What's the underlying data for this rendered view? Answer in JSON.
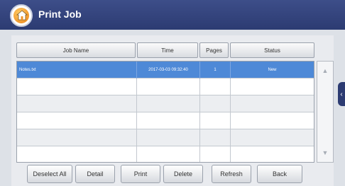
{
  "header": {
    "title": "Print Job",
    "home_icon": "home-icon"
  },
  "columns": {
    "job_name": "Job Name",
    "time": "Time",
    "pages": "Pages",
    "status": "Status"
  },
  "rows": [
    {
      "job_name": "Notes.txt",
      "time": "2017-03-03 09:32:40",
      "pages": "1",
      "status": "New",
      "selected": true
    },
    {
      "job_name": "",
      "time": "",
      "pages": "",
      "status": ""
    },
    {
      "job_name": "",
      "time": "",
      "pages": "",
      "status": ""
    },
    {
      "job_name": "",
      "time": "",
      "pages": "",
      "status": ""
    },
    {
      "job_name": "",
      "time": "",
      "pages": "",
      "status": ""
    },
    {
      "job_name": "",
      "time": "",
      "pages": "",
      "status": ""
    }
  ],
  "buttons": {
    "deselect_all": "Deselect All",
    "detail": "Detail",
    "print": "Print",
    "delete": "Delete",
    "refresh": "Refresh",
    "back": "Back"
  },
  "colors": {
    "header": "#2c3b72",
    "selection": "#4e89d7"
  }
}
